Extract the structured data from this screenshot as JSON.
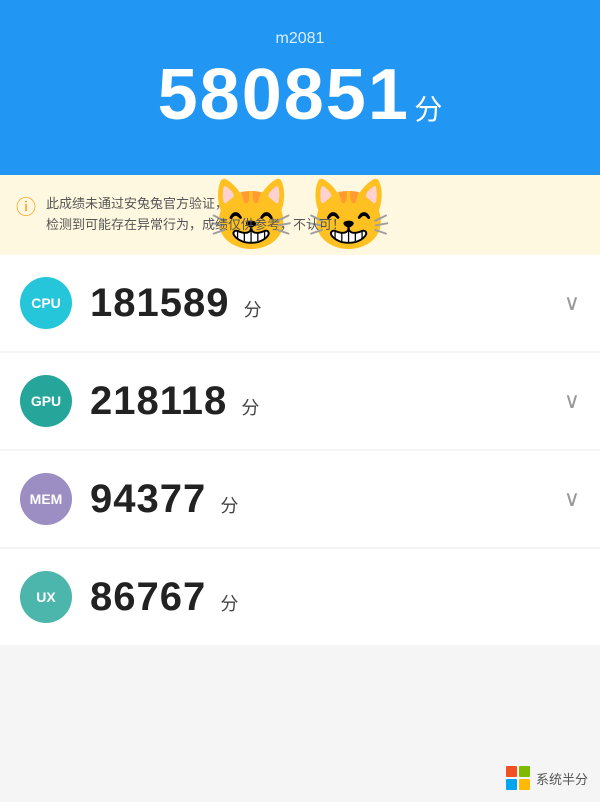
{
  "header": {
    "device": "m2081",
    "total_score": "580851",
    "score_unit": "分"
  },
  "warning": {
    "icon": "⚠",
    "text_line1": "此成绩未通过安兔兔官方验证，",
    "text_line2": "检测到可能存在异常行为，成绩仅供参考，不认可！",
    "emoji1": "🐱",
    "emoji2": "🐱"
  },
  "scores": [
    {
      "id": "cpu",
      "label": "CPU",
      "value": "181589",
      "unit": "分",
      "badge_class": "badge-cpu",
      "has_chevron": true
    },
    {
      "id": "gpu",
      "label": "GPU",
      "value": "218118",
      "unit": "分",
      "badge_class": "badge-gpu",
      "has_chevron": true
    },
    {
      "id": "mem",
      "label": "MEM",
      "value": "94377",
      "unit": "分",
      "badge_class": "badge-mem",
      "has_chevron": true
    },
    {
      "id": "ux",
      "label": "UX",
      "value": "86767",
      "unit": "分",
      "badge_class": "badge-ux",
      "has_chevron": false
    }
  ],
  "watermark": {
    "text": "系统半分"
  }
}
